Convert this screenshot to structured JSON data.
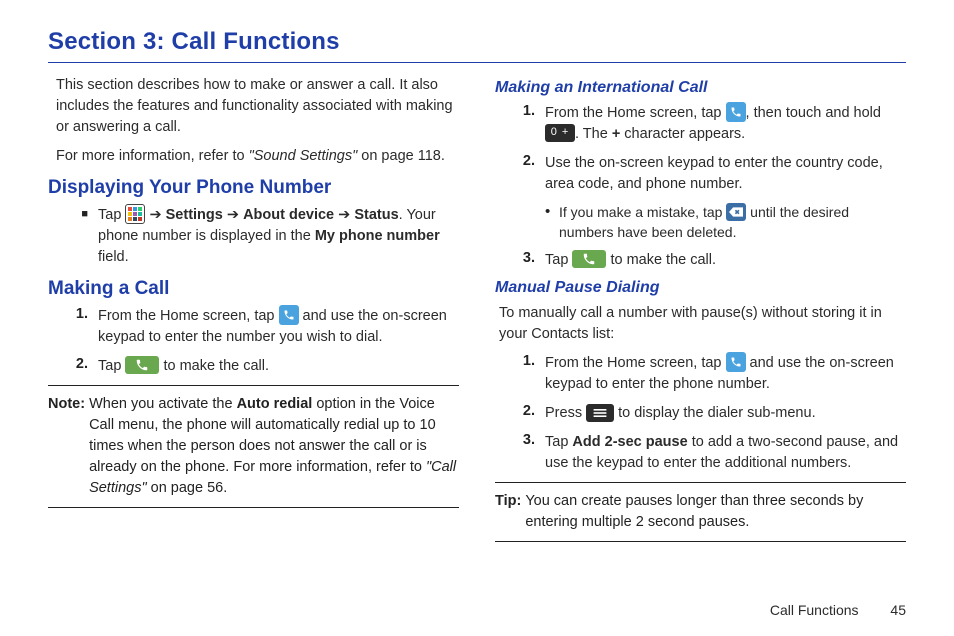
{
  "title": "Section 3: Call Functions",
  "intro": {
    "p1": "This section describes how to make or answer a call. It also includes the features and functionality associated with making or answering a call.",
    "p2_a": "For more information, refer to ",
    "p2_ref": "\"Sound Settings\"",
    "p2_b": " on page 118."
  },
  "left": {
    "h_display": "Displaying Your Phone Number",
    "display_step_a": "Tap ",
    "display_step_b": " ➔ ",
    "display_settings": "Settings",
    "display_about": "About device",
    "display_status": "Status",
    "display_step_c": ". Your phone number is displayed in the ",
    "display_field": "My phone number",
    "display_step_d": " field.",
    "h_making": "Making a Call",
    "mk1_a": "From the Home screen, tap ",
    "mk1_b": " and use the on-screen keypad to enter the number you wish to dial.",
    "mk2_a": "Tap ",
    "mk2_b": " to make the call.",
    "note_label": "Note:",
    "note_a": "When you activate the ",
    "note_bold": "Auto redial",
    "note_b": " option in the Voice Call menu, the phone will automatically redial up to 10 times when the person does not answer the call or is already on the phone. For more information, refer to ",
    "note_ref": "\"Call Settings\"",
    "note_c": " on page 56."
  },
  "right": {
    "h_intl": "Making an International Call",
    "intl1_a": "From the Home screen, tap ",
    "intl1_b": ", then touch and hold ",
    "intl1_c": ". The ",
    "intl1_plus": "+",
    "intl1_d": " character appears.",
    "intl2": "Use the on-screen keypad to enter the country code, area code, and phone number.",
    "intl_sub_a": "If you make a mistake, tap ",
    "intl_sub_b": " until the desired numbers have been deleted.",
    "intl3_a": "Tap ",
    "intl3_b": " to make the call.",
    "h_pause": "Manual Pause Dialing",
    "pause_intro": "To manually call a number with pause(s) without storing it in your Contacts list:",
    "p1_a": "From the Home screen, tap ",
    "p1_b": " and use the on-screen keypad to enter the phone number.",
    "p2_a": "Press ",
    "p2_b": " to display the dialer sub-menu.",
    "p3_a": "Tap ",
    "p3_bold": "Add 2-sec pause",
    "p3_b": " to add a two-second pause, and use the keypad to enter the additional numbers.",
    "tip_label": "Tip:",
    "tip_body": "You can create pauses longer than three seconds by entering multiple 2 second pauses."
  },
  "nums": {
    "one": "1.",
    "two": "2.",
    "three": "3."
  },
  "icons": {
    "zero": "0 +"
  },
  "footer": {
    "label": "Call Functions",
    "page": "45"
  }
}
